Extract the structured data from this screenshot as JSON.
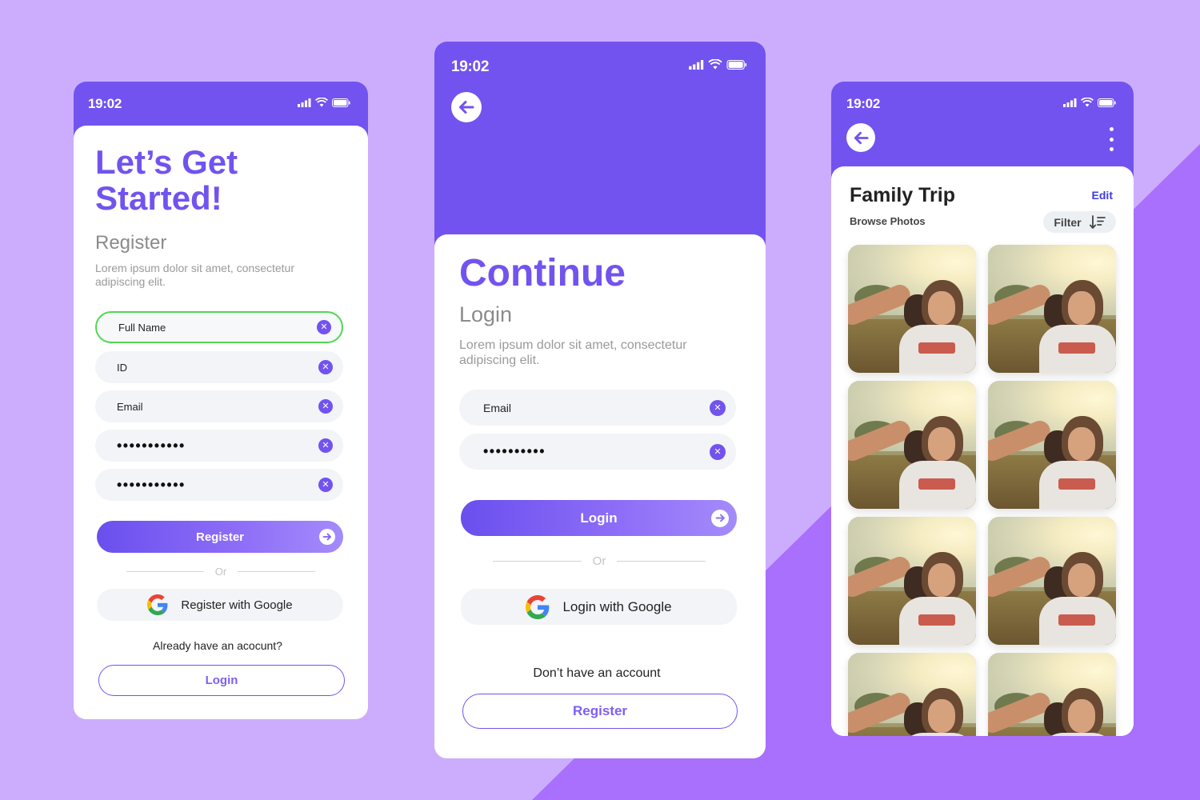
{
  "status_time": "19:02",
  "register_screen": {
    "title": "Let’s Get Started!",
    "subtitle": "Register",
    "description": "Lorem ipsum dolor sit amet, consectetur adipiscing elit.",
    "fields": [
      {
        "placeholder": "Full Name"
      },
      {
        "placeholder": "ID"
      },
      {
        "placeholder": "Email"
      },
      {
        "value": "•••••••••••"
      },
      {
        "value": "•••••••••••"
      }
    ],
    "primary_label": "Register",
    "divider_label": "Or",
    "google_label": "Register with Google",
    "hint": "Already have an acocunt?",
    "secondary_label": "Login"
  },
  "login_screen": {
    "title": "Continue",
    "subtitle": "Login",
    "description": "Lorem ipsum dolor sit amet, consectetur adipiscing elit.",
    "fields": [
      {
        "placeholder": "Email"
      },
      {
        "value": "••••••••••"
      }
    ],
    "primary_label": "Login",
    "divider_label": "Or",
    "google_label": "Login with Google",
    "hint": "Don’t have an account",
    "secondary_label": "Register"
  },
  "album_screen": {
    "title": "Family Trip",
    "subtitle": "Browse Photos",
    "edit_label": "Edit",
    "filter_label": "Filter",
    "photo_count": 8
  },
  "icons": {
    "back": "arrow-left-icon",
    "clear": "close-circle-icon",
    "next": "arrow-right-circle-icon",
    "google": "google-logo-icon",
    "sort": "sort-descending-icon",
    "more": "kebab-menu-icon",
    "signal": "signal-icon",
    "wifi": "wifi-icon",
    "battery": "battery-icon"
  },
  "colors": {
    "brand": "#7253ef",
    "background": "#ccadfd",
    "accent_stripe": "#a96ffd",
    "field_bg": "#f2f4f7",
    "active_border": "#51d851",
    "link": "#3d3ae8"
  }
}
